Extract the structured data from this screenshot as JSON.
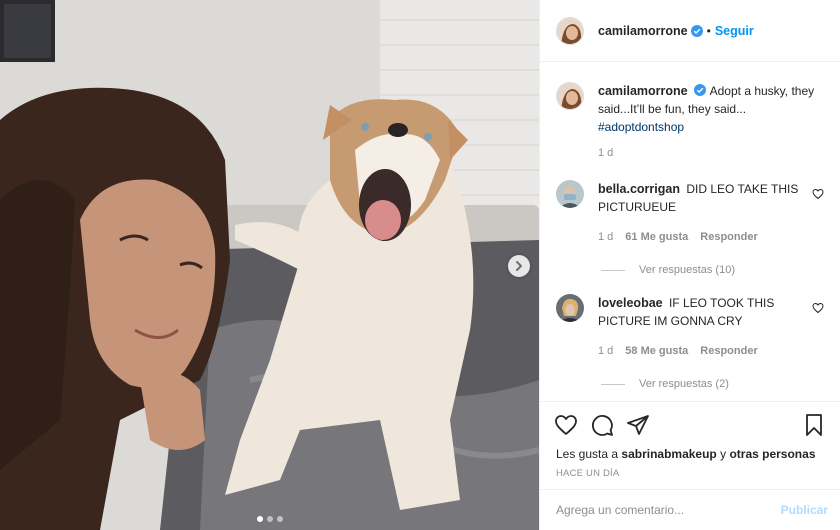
{
  "post": {
    "image_alt": "Selfie with husky",
    "carousel": {
      "count": 3,
      "active": 0
    },
    "colors": {
      "accent": "#0095f6",
      "secondary_text": "#8e8e8e",
      "verified": "#3897f0"
    }
  },
  "header": {
    "username": "camilamorrone",
    "separator": "•",
    "follow_label": "Seguir"
  },
  "caption": {
    "username": "camilamorrone",
    "text": "Adopt a husky, they said...It’ll be fun, they said...",
    "hashtag": "#adoptdontshop",
    "time": "1 d"
  },
  "comments": [
    {
      "username": "bella.corrigan",
      "text": "DID LEO TAKE THIS PICTURUEUE",
      "time": "1 d",
      "likes": "61 Me gusta",
      "reply_label": "Responder",
      "view_replies": "Ver respuestas (10)"
    },
    {
      "username": "loveleobae",
      "text": "IF LEO TOOK THIS PICTURE IM GONNA CRY",
      "time": "1 d",
      "likes": "58 Me gusta",
      "reply_label": "Responder",
      "view_replies": "Ver respuestas (2)"
    }
  ],
  "likes": {
    "prefix": "Les gusta a",
    "user": "sabrinabmakeup",
    "middle": "y",
    "others": "otras personas"
  },
  "timestamp": "HACE UN DÍA",
  "add_comment": {
    "placeholder": "Agrega un comentario...",
    "publish_label": "Publicar"
  }
}
